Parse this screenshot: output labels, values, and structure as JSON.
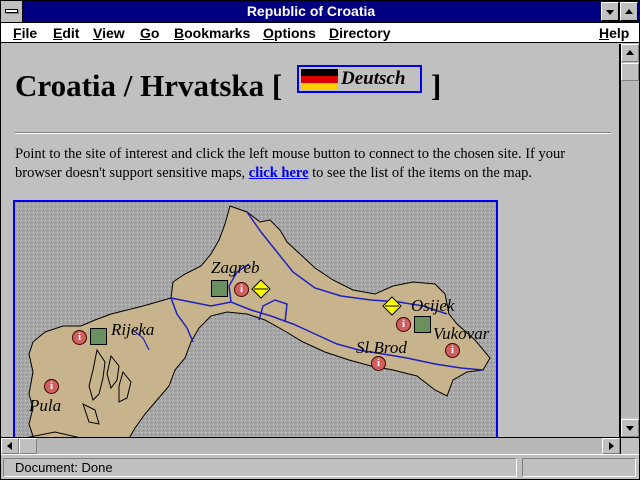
{
  "window": {
    "title": "Republic of Croatia"
  },
  "menubar": {
    "items": [
      {
        "label": "File"
      },
      {
        "label": "Edit"
      },
      {
        "label": "View"
      },
      {
        "label": "Go"
      },
      {
        "label": "Bookmarks"
      },
      {
        "label": "Options"
      },
      {
        "label": "Directory"
      },
      {
        "label": "Help"
      }
    ]
  },
  "page": {
    "heading": "Croatia / Hrvatska [",
    "heading_close": "]",
    "language_link": "Deutsch",
    "intro_before": "Point to the site of interest and click the left mouse button to connect to the chosen site. If your browser doesn't support sensitive maps,",
    "intro_link": "click here",
    "intro_after": "to see the list of the items on the map."
  },
  "map": {
    "cities": [
      {
        "name": "Zagreb"
      },
      {
        "name": "Rijeka"
      },
      {
        "name": "Pula"
      },
      {
        "name": "Osijek"
      },
      {
        "name": "Sl.Brod"
      },
      {
        "name": "Vukovar"
      }
    ],
    "colors": {
      "land": "#c8b48c",
      "sea": "#a8a8a8",
      "rivers": "#2020c0",
      "info": "#d06060",
      "site": "#6a9060",
      "link": "#ffff00"
    }
  },
  "statusbar": {
    "text": "Document: Done"
  }
}
